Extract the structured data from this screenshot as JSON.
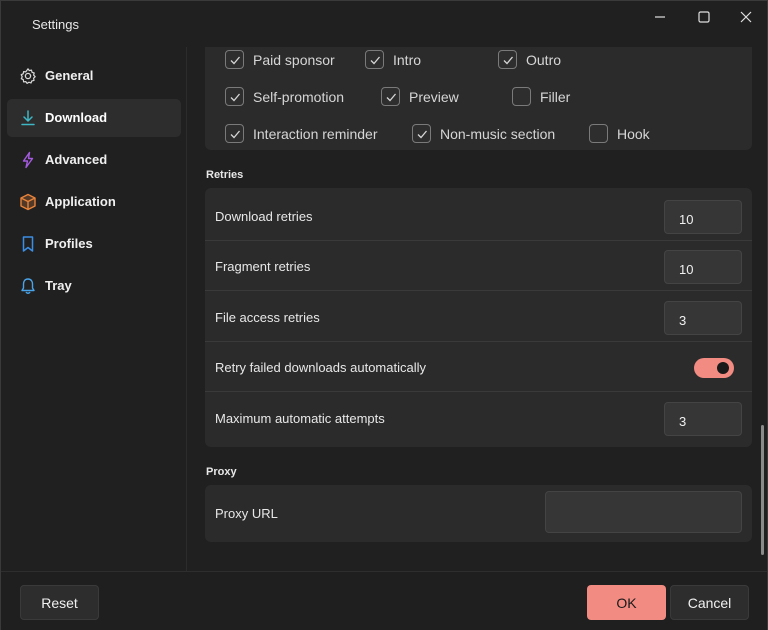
{
  "window": {
    "title": "Settings"
  },
  "sidebar": {
    "items": [
      {
        "label": "General",
        "icon": "gear-icon",
        "active": false
      },
      {
        "label": "Download",
        "icon": "download-icon",
        "active": true
      },
      {
        "label": "Advanced",
        "icon": "lightning-icon",
        "active": false
      },
      {
        "label": "Application",
        "icon": "box-icon",
        "active": false
      },
      {
        "label": "Profiles",
        "icon": "bookmark-icon",
        "active": false
      },
      {
        "label": "Tray",
        "icon": "bell-icon",
        "active": false
      }
    ]
  },
  "sponsorblock": {
    "checkboxes": [
      {
        "label": "Paid sponsor",
        "checked": true
      },
      {
        "label": "Intro",
        "checked": true
      },
      {
        "label": "Outro",
        "checked": true
      },
      {
        "label": "Self-promotion",
        "checked": true
      },
      {
        "label": "Preview",
        "checked": true
      },
      {
        "label": "Filler",
        "checked": false
      },
      {
        "label": "Interaction reminder",
        "checked": true
      },
      {
        "label": "Non-music section",
        "checked": true
      },
      {
        "label": "Hook",
        "checked": false
      }
    ]
  },
  "retries": {
    "title": "Retries",
    "download_retries": {
      "label": "Download retries",
      "value": "10"
    },
    "fragment_retries": {
      "label": "Fragment retries",
      "value": "10"
    },
    "file_access_retries": {
      "label": "File access retries",
      "value": "3"
    },
    "retry_failed": {
      "label": "Retry failed downloads automatically",
      "enabled": true
    },
    "max_attempts": {
      "label": "Maximum automatic attempts",
      "value": "3"
    }
  },
  "proxy": {
    "title": "Proxy",
    "url": {
      "label": "Proxy URL",
      "value": ""
    }
  },
  "footer": {
    "reset_label": "Reset",
    "ok_label": "OK",
    "cancel_label": "Cancel"
  },
  "colors": {
    "accent": "#f28b82",
    "download_icon": "#3fb6c4",
    "advanced_icon": "#a55be0",
    "application_icon": "#e8833a",
    "profiles_icon": "#3a8ee6",
    "tray_icon": "#4aa3e8"
  }
}
